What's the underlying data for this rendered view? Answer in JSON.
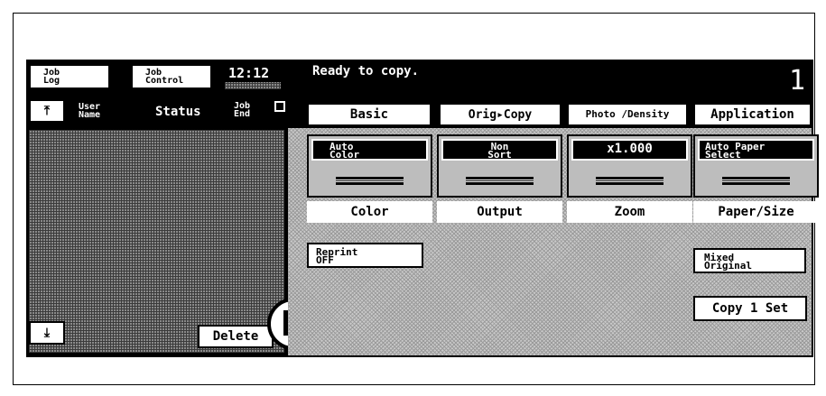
{
  "top_bar": {
    "job_log": [
      "Job",
      "Log"
    ],
    "job_control": [
      "Job",
      "Control"
    ],
    "time": "12:12",
    "message": "Ready to copy.",
    "copies": "1"
  },
  "job_list": {
    "headers": {
      "user_name": [
        "User",
        "Name"
      ],
      "status": "Status",
      "job_end": [
        "Job",
        "End"
      ]
    },
    "delete_label": "Delete"
  },
  "tabs": [
    "Basic",
    "Orig▸Copy",
    "Photo /Density",
    "Application"
  ],
  "functions": [
    {
      "value": [
        "Auto",
        "Color"
      ],
      "label": "Color"
    },
    {
      "value": [
        "Non",
        "Sort"
      ],
      "label": "Output"
    },
    {
      "value": [
        "x1.000"
      ],
      "label": "Zoom"
    },
    {
      "value": [
        "Auto Paper",
        "Select"
      ],
      "label": "Paper/Size"
    }
  ],
  "reprint": [
    "Reprint",
    "OFF"
  ],
  "mixed_original": [
    "Mixed",
    "Original"
  ],
  "copy_set": "Copy 1 Set",
  "icons": {
    "scroll_up": "scroll-up-icon",
    "scroll_down": "scroll-down-icon",
    "panel_toggle": "panel-toggle-icon",
    "alert": "warning-triangle-icon"
  }
}
